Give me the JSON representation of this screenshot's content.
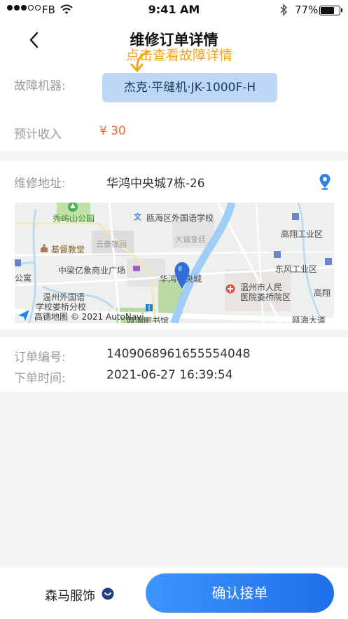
{
  "status_bar": {
    "carrier": "FB",
    "time": "9:41 AM",
    "battery": "77%",
    "battery_level": 0.77
  },
  "nav": {
    "title": "维修订单详情"
  },
  "hint": {
    "text": "点击查看故障详情"
  },
  "machine": {
    "label": "故障机器:",
    "value": "杰克·平缝机·JK-1000F-H"
  },
  "income": {
    "label": "预计收入",
    "value": "¥ 30"
  },
  "address": {
    "label": "维修地址:",
    "value": "华鸿中央城7栋-26"
  },
  "map": {
    "labels": {
      "xiuyu_park": "秀屿山公园",
      "ouhai_school": "瓯海区外国语学校",
      "gaoxiang_industry": "高翔工业区",
      "jidu_church": "基督教堂",
      "yuntai": "云泰锦园",
      "dacheng": "大诚金廷",
      "zhongliang": "中梁亿象商业广场",
      "dongfeng_industry": "东风工业区",
      "gongyu": "公寓",
      "wenzhou_foreign_1": "温州外国语",
      "wenzhou_foreign_2": "学校娄桥分校",
      "huahong": "华鸿中央城",
      "hospital_1": "温州市人民",
      "hospital_2": "医院娄桥院区",
      "gaoxiang": "高翔",
      "library": "瓯海图书馆",
      "ouhai_road": "瓯海大道",
      "attribution": "高德地图 © 2021 AutoNavi"
    }
  },
  "order": {
    "number_label": "订单编号:",
    "number": "1409068961655554048",
    "time_label": "下单时间:",
    "time": "2021-06-27 16:39:54"
  },
  "bottom": {
    "shop_name": "森马服饰",
    "confirm_label": "确认接单"
  },
  "colors": {
    "accent": "#1e6fe8",
    "hint": "#f5a51c",
    "price": "#ee6633",
    "chip_bg": "#bcd8f6"
  }
}
